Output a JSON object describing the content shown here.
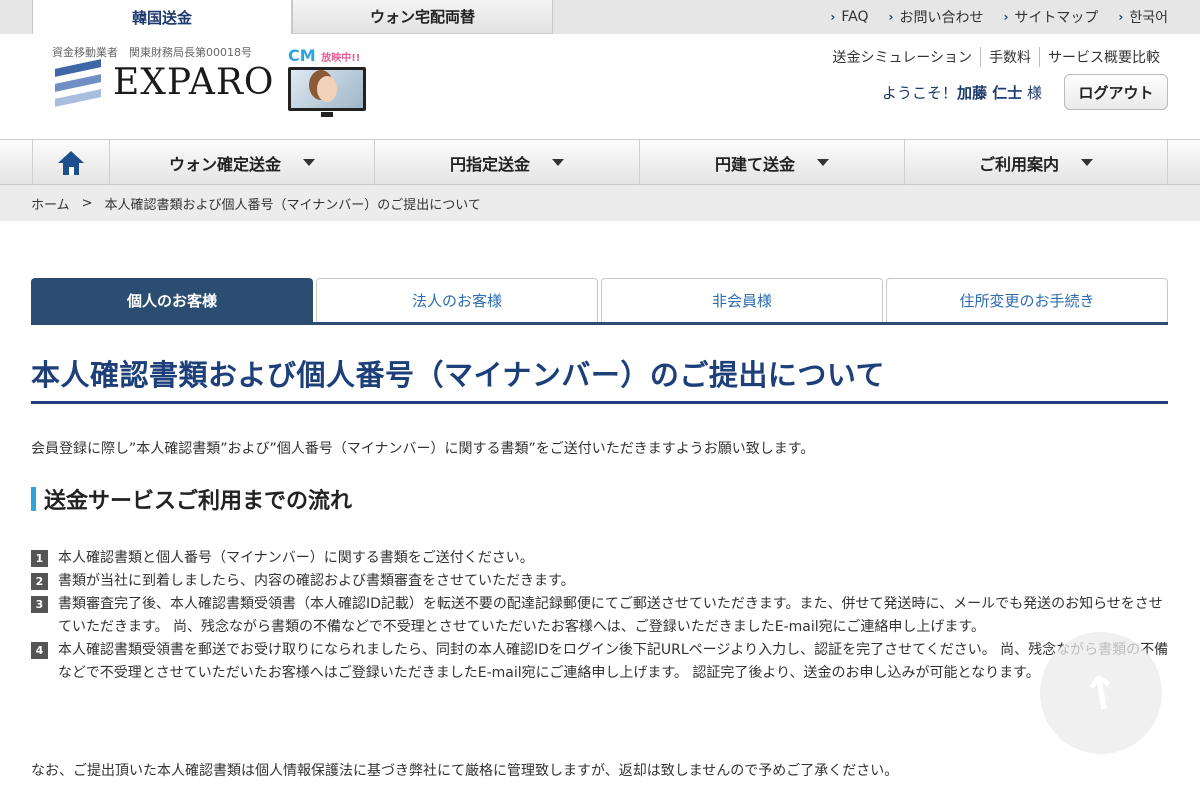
{
  "top_tabs": [
    {
      "label": "韓国送金"
    },
    {
      "label": "ウォン宅配両替"
    }
  ],
  "top_links": [
    {
      "label": "FAQ"
    },
    {
      "label": "お問い合わせ"
    },
    {
      "label": "サイトマップ"
    },
    {
      "label": "한국어"
    }
  ],
  "header": {
    "license": "資金移動業者　関東財務局長第00018号",
    "logo_text": "EXPARO",
    "cm_label": "CM",
    "cm_badge": "放映中!!",
    "links": [
      {
        "label": "送金シミュレーション"
      },
      {
        "label": "手数料"
      },
      {
        "label": "サービス概要比較"
      }
    ],
    "welcome_prefix": "ようこそ！",
    "user_name": "加藤 仁士",
    "welcome_suffix": "様",
    "logout_label": "ログアウト"
  },
  "nav": [
    {
      "label": "ウォン確定送金"
    },
    {
      "label": "円指定送金"
    },
    {
      "label": "円建て送金"
    },
    {
      "label": "ご利用案内"
    }
  ],
  "breadcrumb": {
    "home": "ホーム",
    "separator": ">",
    "current": "本人確認書類および個人番号（マイナンバー）のご提出について"
  },
  "tabs": [
    {
      "label": "個人のお客様"
    },
    {
      "label": "法人のお客様"
    },
    {
      "label": "非会員様"
    },
    {
      "label": "住所変更のお手続き"
    }
  ],
  "content": {
    "title": "本人確認書類および個人番号（マイナンバー）のご提出について",
    "intro": "会員登録に際し”本人確認書類”および”個人番号（マイナンバー）に関する書類”をご送付いただきますようお願い致します。",
    "section_title": "送金サービスご利用までの流れ",
    "steps": [
      {
        "num": "1",
        "text": "本人確認書類と個人番号（マイナンバー）に関する書類をご送付ください。"
      },
      {
        "num": "2",
        "text": "書類が当社に到着しましたら、内容の確認および書類審査をさせていただきます。"
      },
      {
        "num": "3",
        "text": "書類審査完了後、本人確認書類受領書（本人確認ID記載）を転送不要の配達記録郵便にてご郵送させていただきます。また、併せて発送時に、メールでも発送のお知らせをさせていただきます。 尚、残念ながら書類の不備などで不受理とさせていただいたお客様へは、ご登録いただきましたE-mail宛にご連絡申し上げます。"
      },
      {
        "num": "4",
        "text": "本人確認書類受領書を郵送でお受け取りになられましたら、同封の本人確認IDをログイン後下記URLページより入力し、認証を完了させてください。 尚、残念ながら書類の不備などで不受理とさせていただいたお客様へはご登録いただきましたE-mail宛にご連絡申し上げます。 認証完了後より、送金のお申し込みが可能となります。"
      }
    ],
    "footer_note": "なお、ご提出頂いた本人確認書類は個人情報保護法に基づき弊社にて厳格に管理致しますが、返却は致しませんので予めご了承ください。"
  },
  "colors": {
    "brand_navy": "#1d3f7a",
    "tab_active": "#2b4d72",
    "accent_blue": "#2ea3dc",
    "link_blue": "#2d6cb0"
  }
}
